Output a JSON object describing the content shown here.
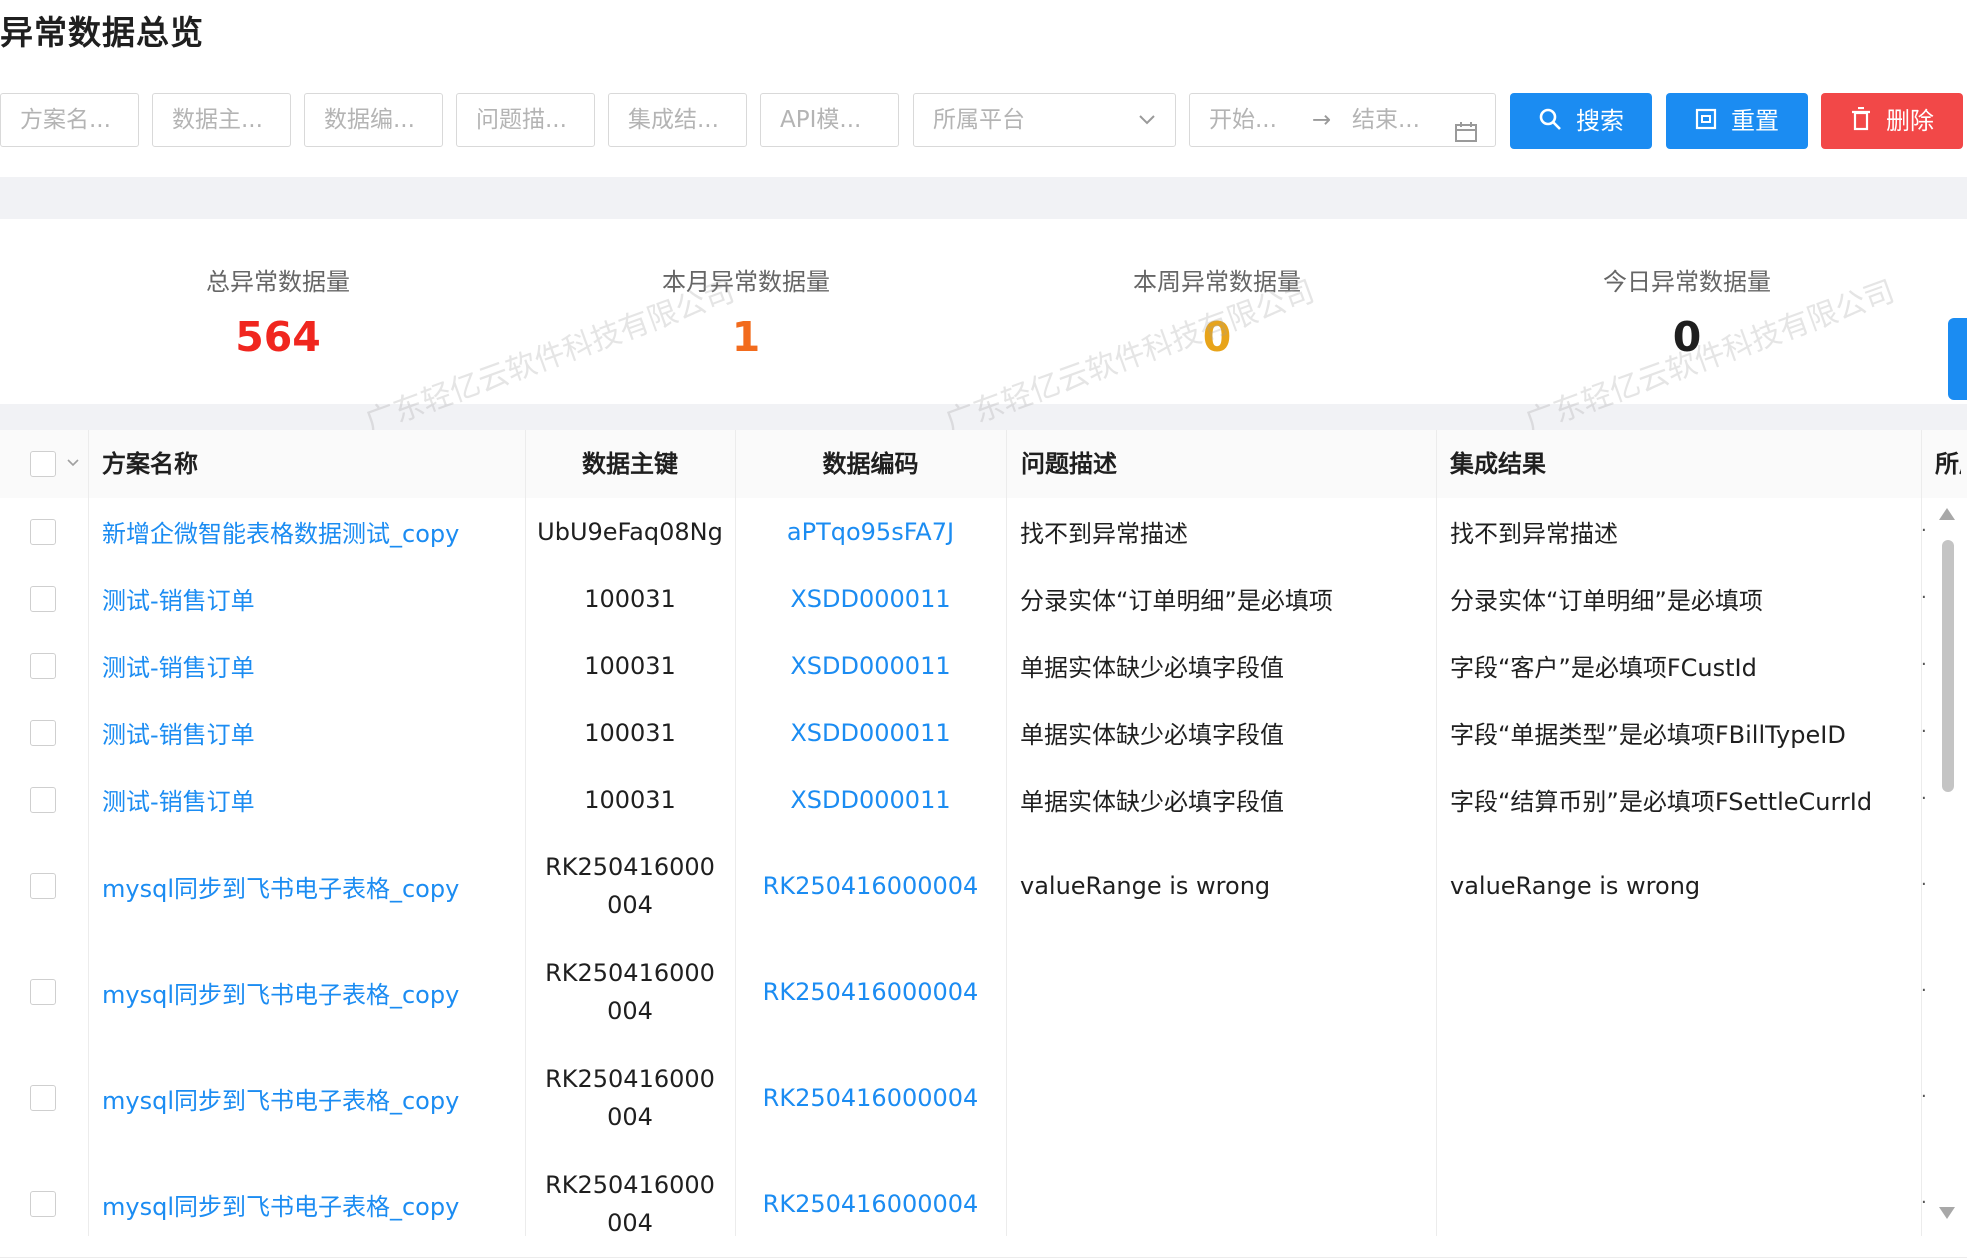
{
  "page": {
    "title": "异常数据总览"
  },
  "filters": {
    "scheme_name": "方案名...",
    "data_key": "数据主...",
    "data_code": "数据编...",
    "problem_desc": "问题描...",
    "integration_result": "集成结...",
    "api_template": "API模...",
    "platform": "所属平台",
    "start": "开始...",
    "range_sep": "→",
    "end": "结束..."
  },
  "buttons": {
    "search": "搜索",
    "reset": "重置",
    "delete": "删除"
  },
  "stats": [
    {
      "label": "总异常数据量",
      "value": "564",
      "color": "#f0261f"
    },
    {
      "label": "本月异常数据量",
      "value": "1",
      "color": "#f26b1d"
    },
    {
      "label": "本周异常数据量",
      "value": "0",
      "color": "#e8a41a"
    },
    {
      "label": "今日异常数据量",
      "value": "0",
      "color": "#1f1f1f"
    }
  ],
  "watermark": "广东轻亿云软件科技有限公司",
  "table": {
    "columns": [
      "方案名称",
      "数据主键",
      "数据编码",
      "问题描述",
      "集成结果",
      "所属"
    ],
    "rows": [
      {
        "scheme": "新增企微智能表格数据测试_copy",
        "key": "UbU9eFaq08Ng",
        "code": "aPTqo95sFA7J",
        "problem": "找不到异常描述",
        "result": "找不到异常描述"
      },
      {
        "scheme": "测试-销售订单",
        "key": "100031",
        "code": "XSDD000011",
        "problem": "分录实体“订单明细”是必填项",
        "result": "分录实体“订单明细”是必填项"
      },
      {
        "scheme": "测试-销售订单",
        "key": "100031",
        "code": "XSDD000011",
        "problem": "单据实体缺少必填字段值",
        "result": "字段“客户”是必填项FCustId"
      },
      {
        "scheme": "测试-销售订单",
        "key": "100031",
        "code": "XSDD000011",
        "problem": "单据实体缺少必填字段值",
        "result": "字段“单据类型”是必填项FBillTypeID"
      },
      {
        "scheme": "测试-销售订单",
        "key": "100031",
        "code": "XSDD000011",
        "problem": "单据实体缺少必填字段值",
        "result": "字段“结算币别”是必填项FSettleCurrId"
      },
      {
        "scheme": "mysql同步到飞书电子表格_copy",
        "key": "RK250416000004",
        "code": "RK250416000004",
        "problem": "valueRange is wrong",
        "result": "valueRange is wrong"
      },
      {
        "scheme": "mysql同步到飞书电子表格_copy",
        "key": "RK250416000004",
        "code": "RK250416000004",
        "problem": "",
        "result": ""
      },
      {
        "scheme": "mysql同步到飞书电子表格_copy",
        "key": "RK250416000004",
        "code": "RK250416000004",
        "problem": "",
        "result": ""
      },
      {
        "scheme": "mysql同步到飞书电子表格_copy",
        "key": "RK250416000004",
        "code": "RK250416000004",
        "problem": "",
        "result": ""
      }
    ]
  }
}
